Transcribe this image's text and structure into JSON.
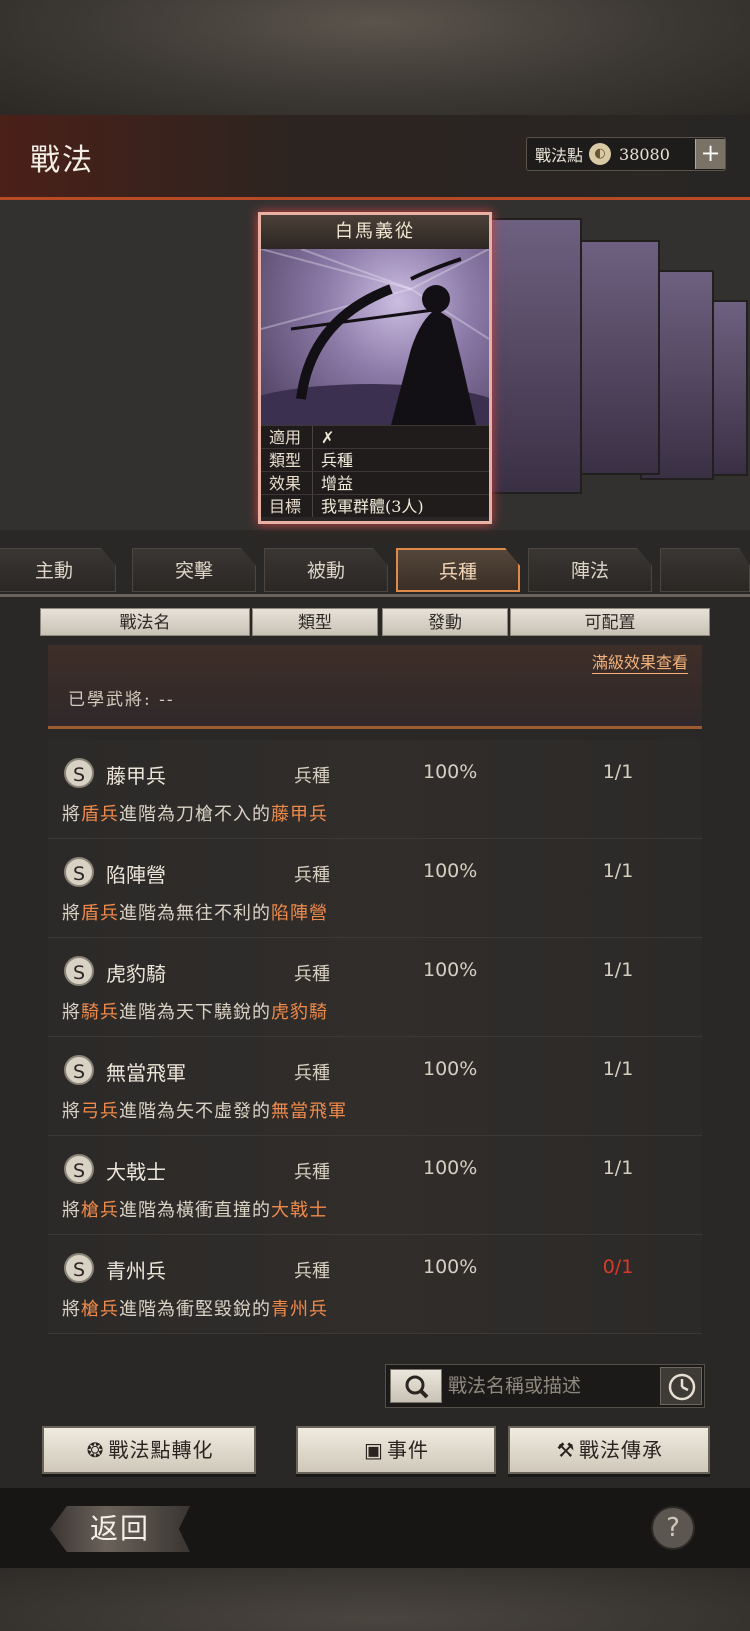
{
  "header": {
    "title": "戰法",
    "points_label": "戰法點",
    "points_value": "38080",
    "add_label": "+"
  },
  "card": {
    "name": "白馬義從",
    "attrs": [
      {
        "key": "適用",
        "value": ""
      },
      {
        "key": "類型",
        "value": "兵種"
      },
      {
        "key": "效果",
        "value": "增益"
      },
      {
        "key": "目標",
        "value": "我軍群體(3人)"
      }
    ]
  },
  "tabs": [
    {
      "label": "主動"
    },
    {
      "label": "突擊"
    },
    {
      "label": "被動"
    },
    {
      "label": "兵種"
    },
    {
      "label": "陣法"
    }
  ],
  "columns": [
    "戰法名",
    "類型",
    "發動",
    "可配置"
  ],
  "detail": {
    "link": "滿級效果查看",
    "learned": "已學武將: --"
  },
  "list": [
    {
      "badge": "S",
      "name": "藤甲兵",
      "type": "兵種",
      "rate": "100%",
      "cfg": "1/1",
      "d1": "將",
      "d2": "盾兵",
      "d3": "進階為刀槍不入的",
      "d4": "藤甲兵"
    },
    {
      "badge": "S",
      "name": "陷陣營",
      "type": "兵種",
      "rate": "100%",
      "cfg": "1/1",
      "d1": "將",
      "d2": "盾兵",
      "d3": "進階為無往不利的",
      "d4": "陷陣營"
    },
    {
      "badge": "S",
      "name": "虎豹騎",
      "type": "兵種",
      "rate": "100%",
      "cfg": "1/1",
      "d1": "將",
      "d2": "騎兵",
      "d3": "進階為天下驍銳的",
      "d4": "虎豹騎"
    },
    {
      "badge": "S",
      "name": "無當飛軍",
      "type": "兵種",
      "rate": "100%",
      "cfg": "1/1",
      "d1": "將",
      "d2": "弓兵",
      "d3": "進階為矢不虛發的",
      "d4": "無當飛軍"
    },
    {
      "badge": "S",
      "name": "大戟士",
      "type": "兵種",
      "rate": "100%",
      "cfg": "1/1",
      "d1": "將",
      "d2": "槍兵",
      "d3": "進階為橫衝直撞的",
      "d4": "大戟士"
    },
    {
      "badge": "S",
      "name": "青州兵",
      "type": "兵種",
      "rate": "100%",
      "cfg": "0/1",
      "d1": "將",
      "d2": "槍兵",
      "d3": "進階為衝堅毀銳的",
      "d4": "青州兵"
    }
  ],
  "search": {
    "placeholder": "戰法名稱或描述"
  },
  "buttons": {
    "convert": "戰法點轉化",
    "event": "事件",
    "inherit": "戰法傳承"
  },
  "footer": {
    "back": "返回",
    "help": "?"
  },
  "colors": {
    "accent": "#f08a4a",
    "tab_active_border": "#e08a4a",
    "red_count": "#d83a2a"
  }
}
